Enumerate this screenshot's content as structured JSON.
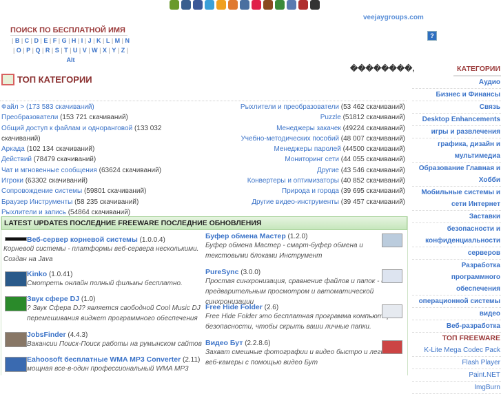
{
  "header": {
    "site": "veejaygroups.com",
    "help": "?",
    "garbled": "��������,",
    "social_icons": [
      "addthis-icon",
      "vkontakte-icon",
      "facebook-icon",
      "twitter-icon",
      "people-icon",
      "friends-icon",
      "pencil-icon",
      "star-icon",
      "bear-icon",
      "google-icon",
      "arrow-icon",
      "grid-icon",
      "delicious-icon"
    ]
  },
  "search": {
    "title": "ПОИСК ПО БЕСПЛАТНОЙ ИМЯ",
    "letters": [
      "B",
      "C",
      "D",
      "E",
      "F",
      "G",
      "H",
      "I",
      "J",
      "K",
      "L",
      "M",
      "N",
      "O",
      "P",
      "Q",
      "R",
      "S",
      "T",
      "U",
      "V",
      "W",
      "X",
      "Y",
      "Z"
    ],
    "alt": "Alt"
  },
  "top_categories": {
    "title": "ТОП КАТЕГОРИИ",
    "left": [
      {
        "name": "Файл > (173 583 скачиваний)",
        "count": ""
      },
      {
        "name": "Преобразователи",
        "count": "(153 721 скачиваний)"
      },
      {
        "name": "Общий доступ к файлам и одноранговой",
        "count": "(133 032 скачиваний)"
      },
      {
        "name": "Аркада",
        "count": "(102 134 скачиваний)"
      },
      {
        "name": "Действий",
        "count": "(78479 скачиваний)"
      },
      {
        "name": "Чат и мгновенные сообщения",
        "count": "(63624 скачиваний)"
      },
      {
        "name": "Игроки",
        "count": "(63302 скачиваний)"
      },
      {
        "name": "Сопровождение системы",
        "count": "(59801 скачиваний)"
      },
      {
        "name": "Браузер Инструменты",
        "count": "(58 235 скачиваний)"
      },
      {
        "name": "Рыхлители и запись",
        "count": "(54864 скачиваний)"
      }
    ],
    "right": [
      {
        "name": "Рыхлители и преобразователи",
        "count": "(53 462 скачиваний)"
      },
      {
        "name": "Puzzle",
        "count": "(51812 скачиваний)"
      },
      {
        "name": "Менеджеры закачек",
        "count": "(49224 скачиваний)"
      },
      {
        "name": "Учебно-методических пособий",
        "count": "(48 007 скачиваний)"
      },
      {
        "name": "Менеджеры паролей",
        "count": "(44500 скачиваний)"
      },
      {
        "name": "Мониторинг сети",
        "count": "(44 055 скачиваний)"
      },
      {
        "name": "Другие",
        "count": "(43 546 скачиваний)"
      },
      {
        "name": "Конвертеры и оптимизаторы",
        "count": "(40 852 скачиваний)"
      },
      {
        "name": "Природа и города",
        "count": "(39 695 скачиваний)"
      },
      {
        "name": "Другие видео-инструменты",
        "count": "(39 457 скачиваний)"
      }
    ]
  },
  "latest": {
    "title": "LATEST UPDATES ПОСЛЕДНИЕ FREEWARE ПОСЛЕДНИЕ ОБНОВЛЕНИЯ",
    "left": [
      {
        "title": "Веб-сервер корневой системы",
        "version": "(1.0.0.4)",
        "desc": "Корневой системы - платформы веб-сервера несколькими. Создан на Java"
      },
      {
        "title": "Kinko",
        "version": "(1.0.41)",
        "desc": "Смотреть онлайн полный фильмы бесплатно."
      },
      {
        "title": "Звук сфере DJ",
        "version": "(1.0)",
        "desc": "? Звук Сфера DJ? является свободной Cool Music DJ перемешивания виджет программного обеспечения"
      },
      {
        "title": "JobsFinder",
        "version": "(4.4.3)",
        "desc": "Вакансии Поиск-Поиск работы на румынском сайтов"
      },
      {
        "title": "Eahoosoft бесплатные WMA MP3 Converter",
        "version": "(2.11)",
        "desc": "мощная все-в-один профессиональный WMA MP3"
      }
    ],
    "right": [
      {
        "title": "Буфер обмена Мастер",
        "version": "(1.2.0)",
        "desc": "Буфер обмена Мастер - смарт-буфер обмена и текстовыми блоками Инструмент"
      },
      {
        "title": "PureSync",
        "version": "(3.0.0)",
        "desc": "Простая синхронизация, сравнение файлов и папок - с предварительным просмотром и автоматической синхронизации"
      },
      {
        "title": "Free Hide Folder",
        "version": "(2.6)",
        "desc": "Free Hide Folder это бесплатная программа компьютерной безопасности, чтобы скрыть ваши личные папки."
      },
      {
        "title": "Видео Бут",
        "version": "(2.2.8.6)",
        "desc": "Захват смешные фотографии и видео быстро и легко с веб-камеры с помощью видео Бут"
      }
    ]
  },
  "sidebar": {
    "categories_title": "КАТЕГОРИИ",
    "categories": [
      "Аудио",
      "Бизнес и Финансы",
      "Связь",
      "Desktop Enhancements",
      "игры и развлечения",
      "графика, дизайн и мультимедиа",
      "Образование Главная и Хобби",
      "Мобильные системы и сети Интернет",
      "Заставки",
      "безопасности и конфиденциальности",
      "серверов",
      "Разработка программного обеспечения",
      "операционной системы",
      "видео",
      "Веб-разработка"
    ],
    "freeware_title": "ТОП FREEWARE",
    "freeware": [
      "K-Lite Mega Codec Pack",
      "Flash Player",
      "Paint.NET",
      "ImgBurn"
    ]
  }
}
